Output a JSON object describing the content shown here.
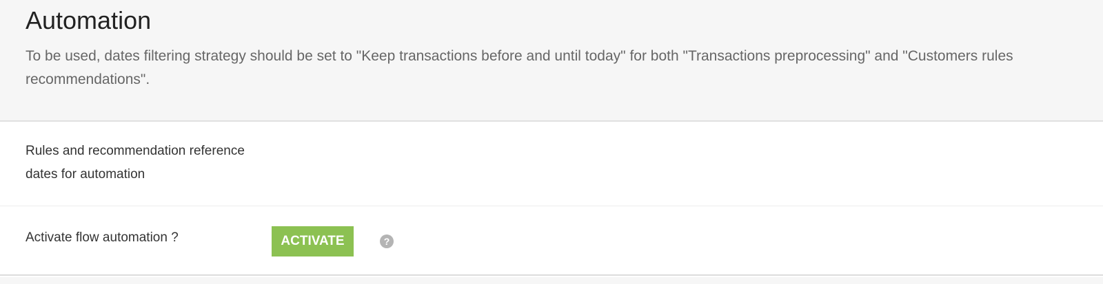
{
  "header": {
    "title": "Automation",
    "description": "To be used, dates filtering strategy should be set to \"Keep transactions before and until today\" for both \"Transactions preprocessing\" and \"Customers rules recommendations\"."
  },
  "settings": {
    "reference_dates_label": "Rules and recommendation reference dates for automation",
    "activate_flow_label": "Activate flow automation ?",
    "activate_button_label": "ACTIVATE",
    "help_icon_glyph": "?"
  },
  "colors": {
    "header_background": "#f6f6f6",
    "activate_button": "#8cc152",
    "help_icon": "#b4b4b4"
  },
  "icons": {
    "help": "question-circle-icon"
  }
}
